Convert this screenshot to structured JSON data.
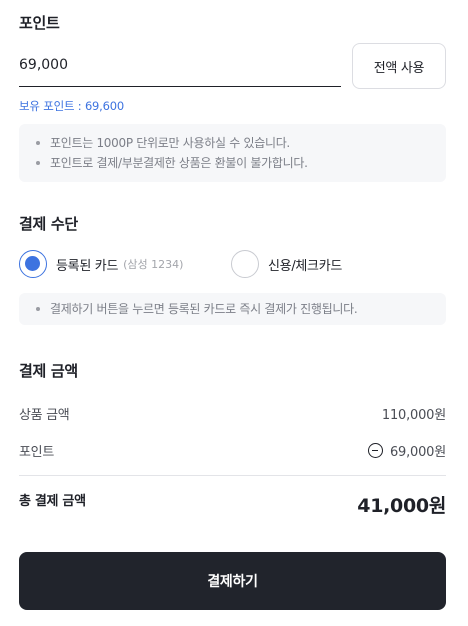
{
  "points": {
    "title": "포인트",
    "input_value": "69,000",
    "use_all_label": "전액 사용",
    "owned_label": "보유 포인트 : 69,600",
    "notices": [
      "포인트는 1000P 단위로만 사용하실 수 있습니다.",
      "포인트로 결제/부분결제한 상품은 환불이 불가합니다."
    ]
  },
  "payment_method": {
    "title": "결제 수단",
    "options": [
      {
        "label": "등록된 카드",
        "sub": "(삼성 1234)",
        "selected": true
      },
      {
        "label": "신용/체크카드",
        "selected": false
      }
    ],
    "notice": "결제하기 버튼을 누르면 등록된 카드로 즉시 결제가 진행됩니다."
  },
  "payment_amount": {
    "title": "결제 금액",
    "product_label": "상품 금액",
    "product_value": "110,000원",
    "point_label": "포인트",
    "point_value": "69,000원",
    "total_label": "총 결제 금액",
    "total_value": "41,000원"
  },
  "pay_button": {
    "label": "결제하기"
  },
  "colors": {
    "accent": "#3d73e0",
    "button_dark": "#21242c",
    "notice_bg": "#f6f7f9"
  }
}
